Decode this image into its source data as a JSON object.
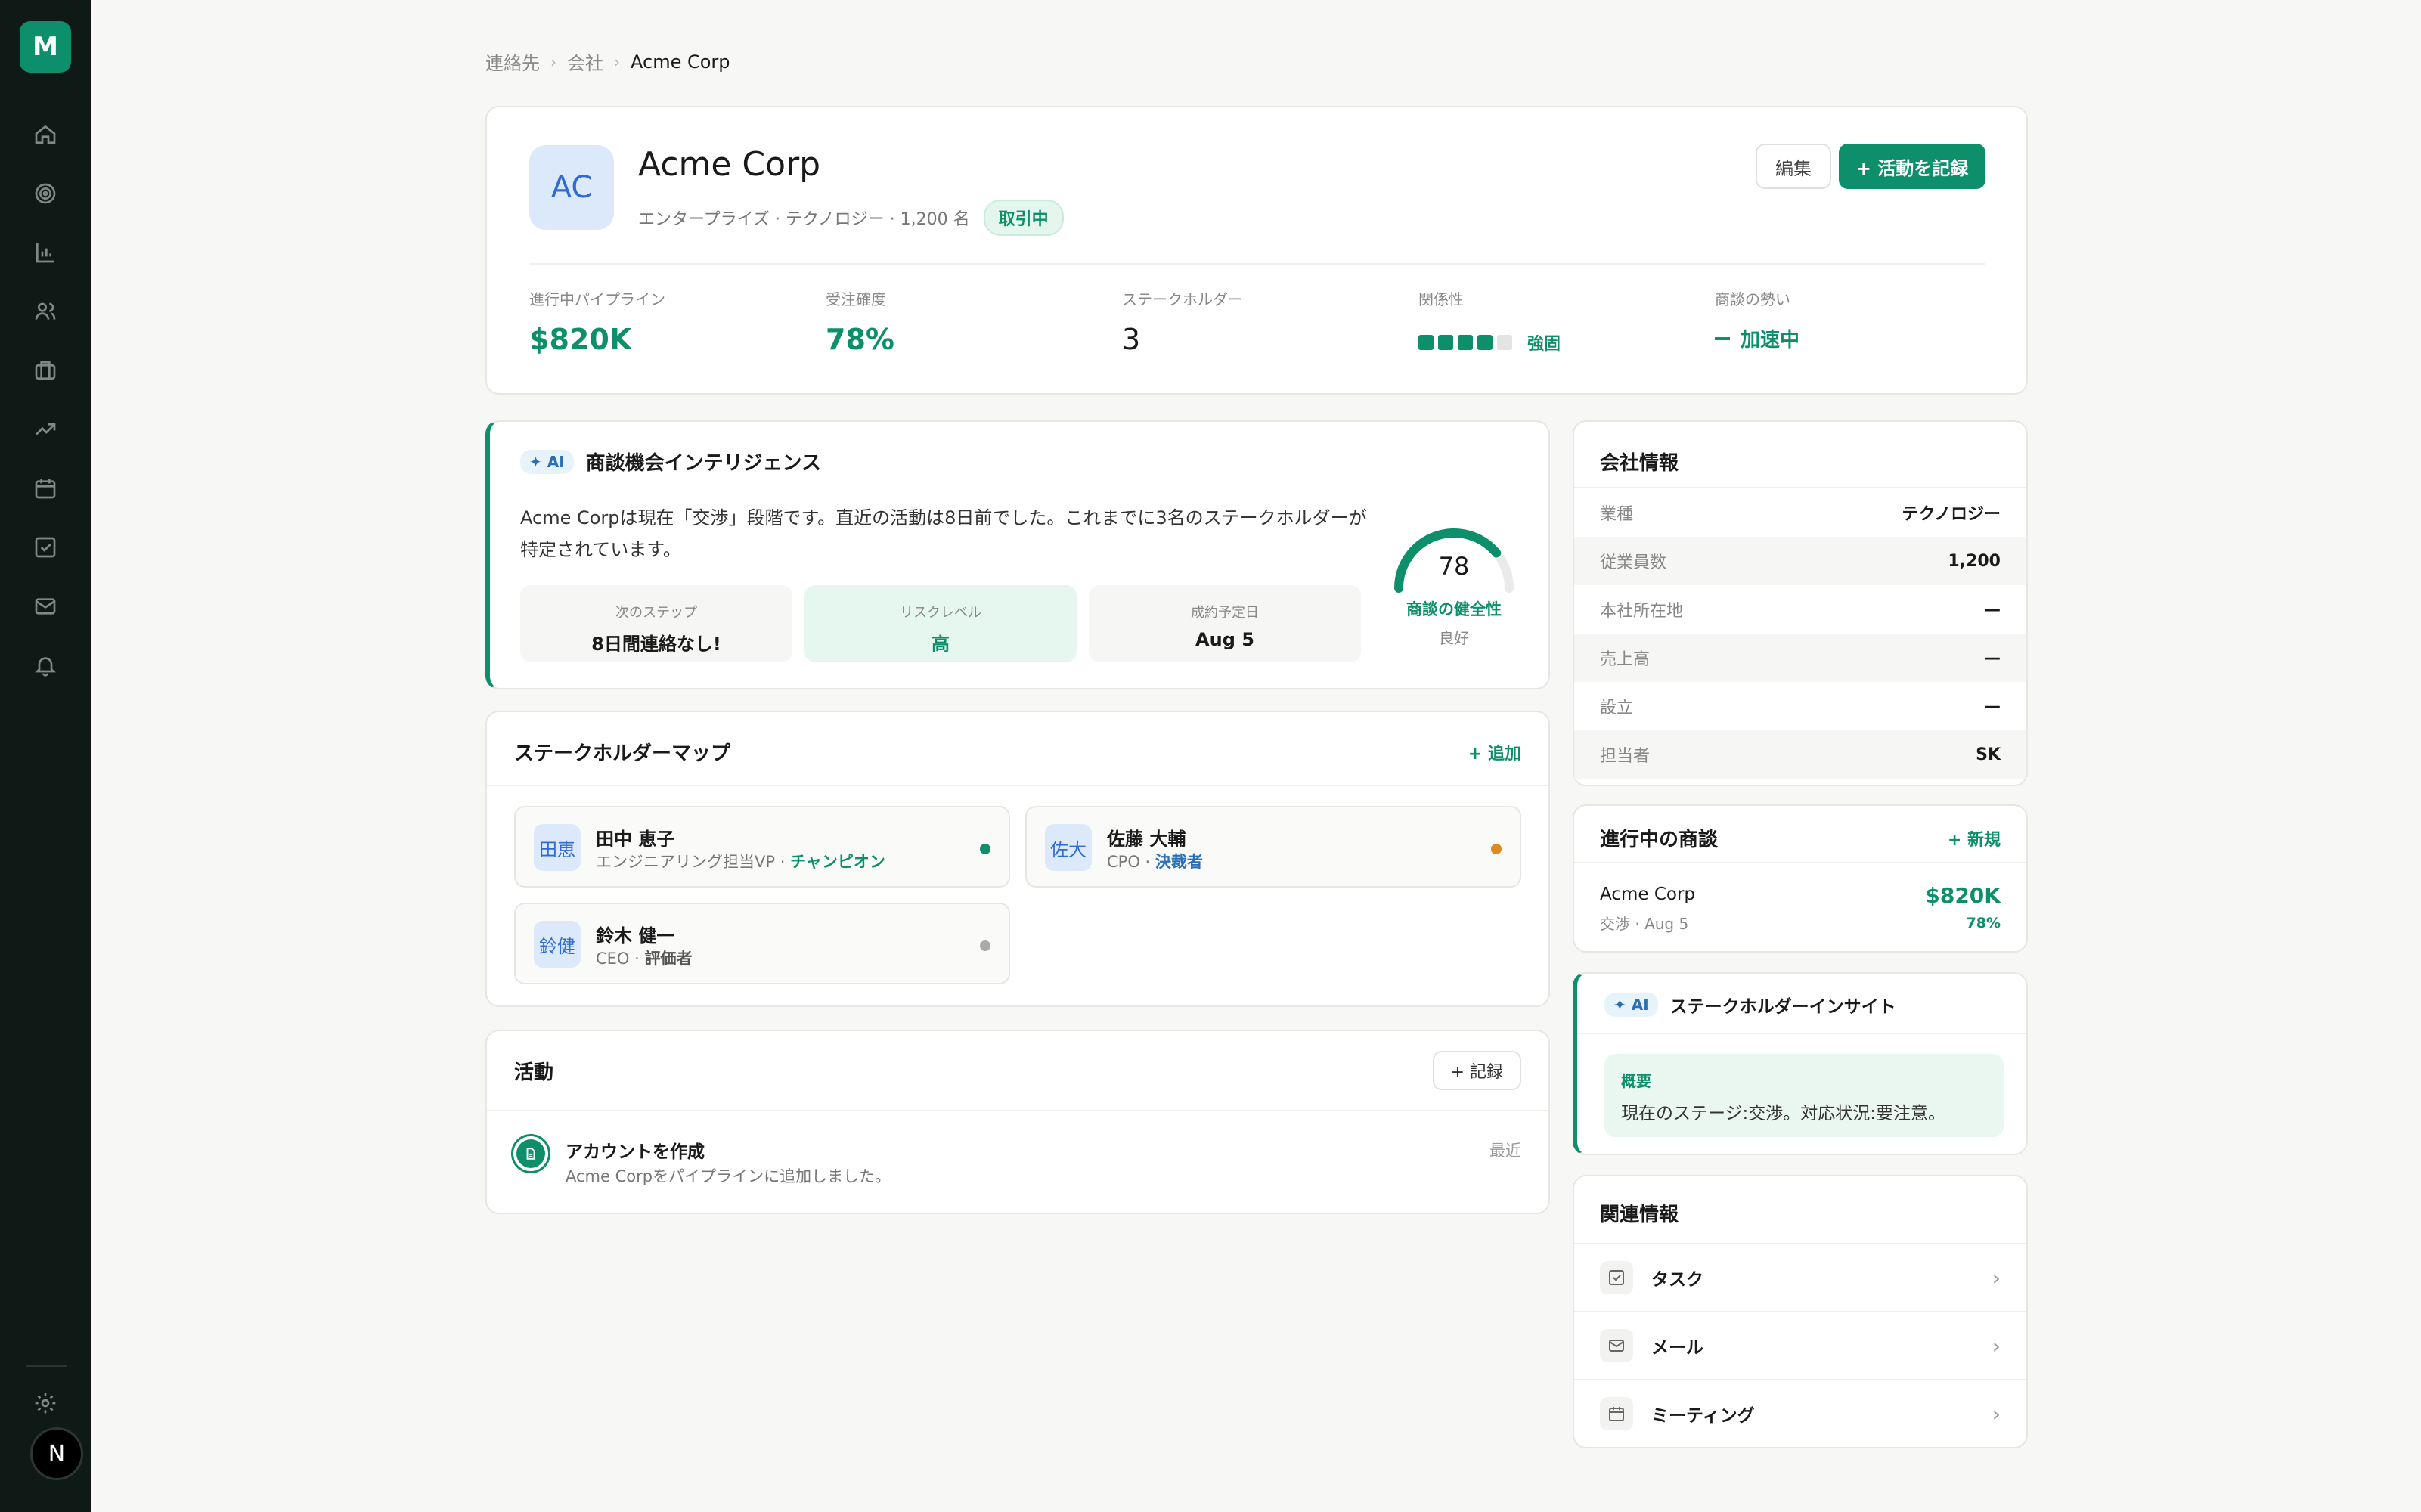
{
  "app": {
    "logo_letter": "M",
    "user_initial": "N"
  },
  "sidebar": {
    "icons": [
      "home-icon",
      "target-icon",
      "bar-chart-icon",
      "users-icon",
      "briefcase-icon",
      "trend-icon",
      "calendar-icon",
      "checkbox-icon",
      "mail-icon",
      "bell-icon"
    ],
    "settings_icon": "gear-icon"
  },
  "breadcrumb": {
    "items": [
      "連絡先",
      "会社"
    ],
    "current": "Acme Corp"
  },
  "company": {
    "initials": "AC",
    "name": "Acme Corp",
    "meta": "エンタープライズ · テクノロジー · 1,200 名",
    "status": "取引中",
    "edit_label": "編集",
    "log_activity_label": "+ 活動を記録"
  },
  "stats": {
    "pipeline_label": "進行中パイプライン",
    "pipeline_value": "$820K",
    "probability_label": "受注確度",
    "probability_value": "78%",
    "stakeholders_label": "ステークホルダー",
    "stakeholders_value": "3",
    "relationship_label": "関係性",
    "relationship_value": "強固",
    "relationship_level": 4,
    "relationship_max": 5,
    "momentum_label": "商談の勢い",
    "momentum_value": "加速中"
  },
  "ai_intel": {
    "badge": "✦ AI",
    "title": "商談機会インテリジェンス",
    "summary": "Acme Corpは現在「交渉」段階です。直近の活動は8日前でした。これまでに3名のステークホルダーが特定されています。",
    "next_step_label": "次のステップ",
    "next_step_value": "8日間連絡なし!",
    "risk_label": "リスクレベル",
    "risk_value": "高",
    "close_date_label": "成約予定日",
    "close_date_value": "Aug 5",
    "health_score": 78,
    "health_max": 100,
    "health_label": "商談の健全性",
    "health_status": "良好"
  },
  "stakeholder_map": {
    "title": "ステークホルダーマップ",
    "add_label": "+ 追加",
    "people": [
      {
        "initials": "田恵",
        "name": "田中 恵子",
        "title": "エンジニアリング担当VP · ",
        "tag": "チャンピオン",
        "tag_color": "#0e8f6b",
        "dot_color": "#0e8f6b"
      },
      {
        "initials": "佐大",
        "name": "佐藤 大輔",
        "title": "CPO · ",
        "tag": "決裁者",
        "tag_color": "#2a6fb5",
        "dot_color": "#e08a1e"
      },
      {
        "initials": "鈴健",
        "name": "鈴木 健一",
        "title": "CEO · ",
        "tag": "評価者",
        "tag_color": "#555555",
        "dot_color": "#aaaaaa"
      }
    ]
  },
  "activity": {
    "title": "活動",
    "record_label": "+ 記録",
    "items": [
      {
        "title": "アカウントを作成",
        "desc": "Acme Corpをパイプラインに追加しました。",
        "time": "最近"
      }
    ]
  },
  "company_info": {
    "title": "会社情報",
    "rows": [
      {
        "key": "業種",
        "value": "テクノロジー"
      },
      {
        "key": "従業員数",
        "value": "1,200"
      },
      {
        "key": "本社所在地",
        "value": "—"
      },
      {
        "key": "売上高",
        "value": "—"
      },
      {
        "key": "設立",
        "value": "—"
      },
      {
        "key": "担当者",
        "value": "SK"
      }
    ]
  },
  "deals": {
    "title": "進行中の商談",
    "new_label": "+ 新規",
    "items": [
      {
        "name": "Acme Corp",
        "sub": "交渉 · Aug 5",
        "amount": "$820K",
        "probability": "78%"
      }
    ]
  },
  "stakeholder_insight": {
    "badge": "✦ AI",
    "title": "ステークホルダーインサイト",
    "box_title": "概要",
    "box_text": "現在のステージ:交渉。対応状況:要注意。"
  },
  "related": {
    "title": "関連情報",
    "items": [
      {
        "label": "タスク",
        "icon": "checkbox-icon"
      },
      {
        "label": "メール",
        "icon": "mail-icon"
      },
      {
        "label": "ミーティング",
        "icon": "calendar-icon"
      }
    ]
  },
  "colors": {
    "accent": "#0e8f6b",
    "sidebar_bg": "#0f1a16",
    "avatar_bg": "#dce9fb"
  }
}
